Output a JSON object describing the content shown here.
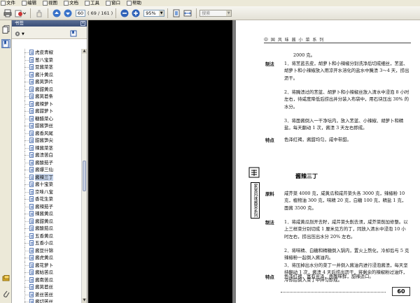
{
  "menu": [
    {
      "label": "文件"
    },
    {
      "label": "编辑"
    },
    {
      "label": "视图"
    },
    {
      "label": "文档"
    },
    {
      "label": "工具"
    },
    {
      "label": "窗口"
    },
    {
      "label": "帮助"
    }
  ],
  "toolbar": {
    "page_current": "60",
    "page_count": "( 69 / 161 )",
    "zoom": "95%",
    "search_placeholder": "搜索"
  },
  "bookmarks": {
    "title": "书签",
    "items": [
      {
        "label": "虎皮青椒"
      },
      {
        "label": "葱八宝菜"
      },
      {
        "label": "豆酱菜茎"
      },
      {
        "label": "酱汁黄瓜"
      },
      {
        "label": "酱莴笋片"
      },
      {
        "label": "酱甜黄瓜"
      },
      {
        "label": "酱莴苣条"
      },
      {
        "label": "酱辣萝卜"
      },
      {
        "label": "酱甜萝卜"
      },
      {
        "label": "糖醋菜心"
      },
      {
        "label": "甜酱笋丝"
      },
      {
        "label": "酱香风尾"
      },
      {
        "label": "甜酱笋尖"
      },
      {
        "label": "辣酱菜茎"
      },
      {
        "label": "酱渍苦白"
      },
      {
        "label": "酱酸茄子"
      },
      {
        "label": "酱爆三仙"
      },
      {
        "label": "酱辣三丁",
        "selected": true
      },
      {
        "label": "酱十宝菜"
      },
      {
        "label": "京味八宝"
      },
      {
        "label": "香花生菜"
      },
      {
        "label": "酱辣茄子"
      },
      {
        "label": "辣酱黄瓜"
      },
      {
        "label": "酱甜黄瓜"
      },
      {
        "label": "酱酸茄瓜"
      },
      {
        "label": "五香黄瓜"
      },
      {
        "label": "五香小瓜"
      },
      {
        "label": "酱豆什锦"
      },
      {
        "label": "酱虎黄瓜"
      },
      {
        "label": "酱花萝卜"
      },
      {
        "label": "酱姑苦瓜"
      },
      {
        "label": "酱南苦瓜"
      },
      {
        "label": "酱莴苣丝"
      },
      {
        "label": "姜丝苦丝"
      },
      {
        "label": "酱切苦丝"
      },
      {
        "label": "甜酱茄条"
      }
    ]
  },
  "page": {
    "header": "中 国 风 味 酱 小 菜 系 列",
    "line_top": "2000 克。",
    "tag_method1": "制法",
    "method1": "1．将苤蓝去皮，胡萝卜和小辣椒分别洗净后切成细丝，苤蓝、胡萝卜和小辣椒放入用凉开水溶化的盐水中腌渍 3～4 天，捞出沥干。",
    "method1b": "2．将腌渍过的苤蓝、胡萝卜和小辣椒丝放入清水中浸泡 8 小时左右，待咸度降低后捞出并分装入布袋中，用石块压出 30% 的水分。",
    "method1c": "3．将面酱倒入一干净坛内，放入苤蓝、小辣椒、胡萝卜和精盐，每天翻动 1 次，酱渍 3 天左右即成。",
    "tag_feature1": "特点",
    "feature1": "色泽红褐，酱甜均匀，咸中带甜。",
    "dish_title": "酱辣三丁",
    "tag_material": "原料",
    "material": "咸芥菜 4000 克，咸黄瓜和咸芹菜头各 3000 克，辣椒粉 10 克，植物油 300 克，味精 20 克，白糖 100 克，精盐 1 克，面酱 3500 克。",
    "tag_method2": "制法",
    "method2": "1．将咸黄瓜剖开去籽，咸芹菜头削去须，咸芥菜削加修整。以上三样菜分别切成 1 厘米见方的丁，同放入清水中浸泡 10 小时左右，捞出压出水分 20% 左右。",
    "method2b": "2．将味精、白糖和精糖倒入锅内，置火上熬化，冷却后与 5 克辣椒粉一起倒入酱油内。",
    "method2c": "3．将压掉出水分的菜丁一并倒入酱油内进行浸泡酱渍，每天坚持翻动 1 次，酱渍 4 天后捞出沥干，将剩余的辣椒粉过油炸，冷却后倒入菜丁中拌匀即成。",
    "tag_feature2": "特点",
    "feature2": "色泽红褐，富有光泽，质脆味鲜，甜辣适口。",
    "side_text": "家常风味酱菜系列",
    "page_number": "60"
  },
  "colors": {
    "panel_title": "#3a4e78",
    "selection": "#c5d3ea",
    "doc_bg": "#7a7a7a"
  }
}
